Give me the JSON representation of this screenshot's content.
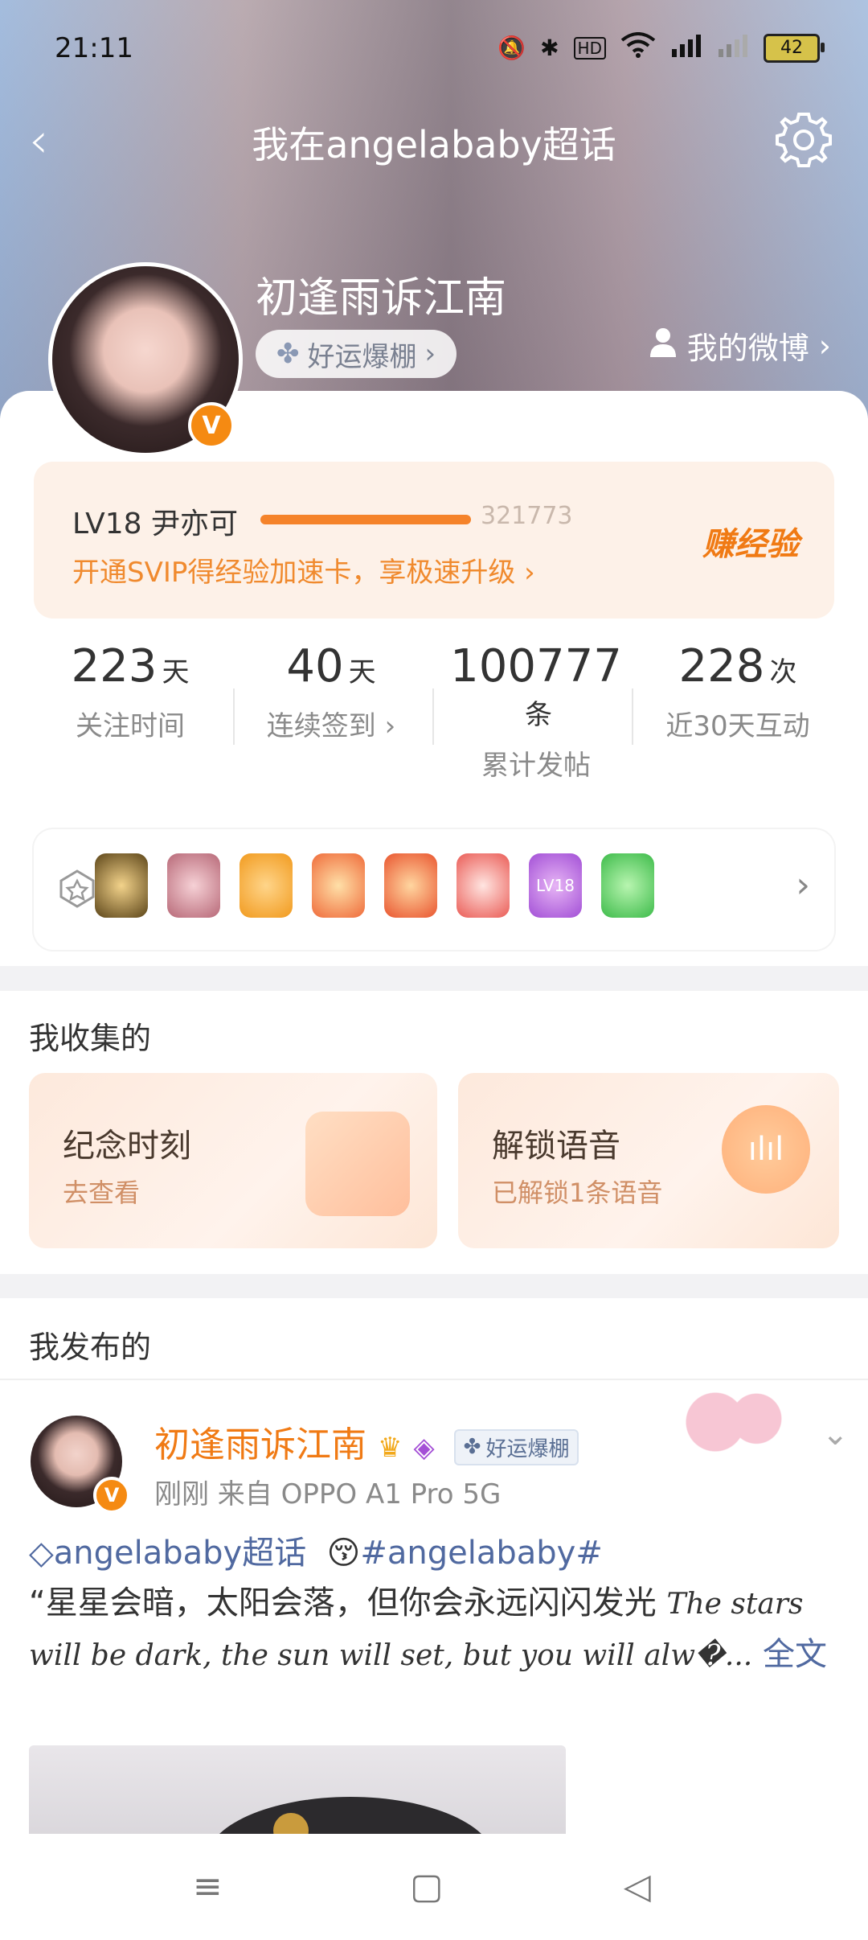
{
  "status_bar": {
    "time": "21:11",
    "battery": "42"
  },
  "nav": {
    "title": "我在angelababy超话"
  },
  "profile": {
    "name": "初逢雨诉江南",
    "luck_badge": "好运爆棚",
    "my_weibo": "我的微博"
  },
  "level": {
    "title": "LV18 尹亦可",
    "points": "321773",
    "subtitle": "开通SVIP得经验加速卡，享极速升级 ›",
    "earn_label": "赚经验",
    "progress_fraction": 0.95
  },
  "stats": [
    {
      "value": "223",
      "unit": "天",
      "label": "关注时间"
    },
    {
      "value": "40",
      "unit": "天",
      "label": "连续签到 ›"
    },
    {
      "value": "100777",
      "unit": "条",
      "label": "累计发帖"
    },
    {
      "value": "228",
      "unit": "次",
      "label": "近30天互动"
    }
  ],
  "medals": {
    "icons": [
      "super-crown",
      "bunny-girl",
      "gold-crown",
      "lion",
      "tiger",
      "rabbit",
      "lv18",
      "green-hand"
    ],
    "lv_label": "LV18"
  },
  "collection": {
    "title": "我收集的",
    "tiles": [
      {
        "title": "纪念时刻",
        "subtitle": "去查看"
      },
      {
        "title": "解锁语音",
        "subtitle": "已解锁1条语音"
      }
    ]
  },
  "posts": {
    "title": "我发布的",
    "author": "初逢雨诉江南",
    "luck_chip": "好运爆棚",
    "meta": "刚刚   来自 OPPO A1 Pro 5G",
    "topic": "angelababy超话",
    "hashtag": "#angelababy#",
    "text_cn": "“星星会暗，太阳会落，但你会永远闪闪发光",
    "text_en": "The stars will be dark, the sun will set, but you will alw�...",
    "more": "全文"
  },
  "colors": {
    "accent": "#f07a14",
    "link": "#5069a0"
  }
}
